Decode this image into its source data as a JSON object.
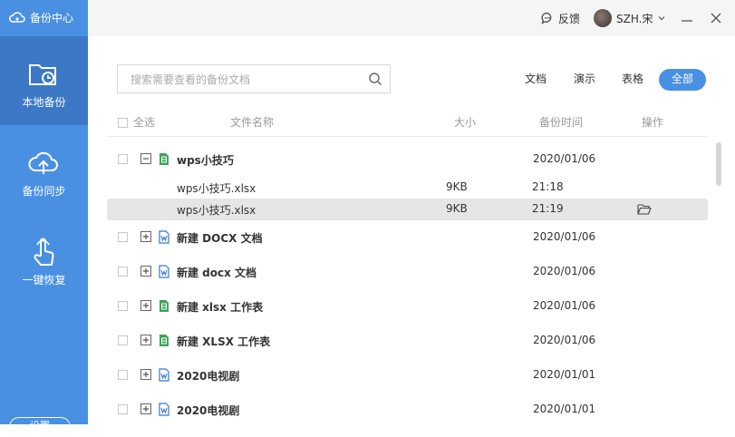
{
  "app": {
    "title": "备份中心"
  },
  "sidebar": {
    "items": [
      {
        "label": "本地备份",
        "icon": "folder-clock-icon",
        "active": true
      },
      {
        "label": "备份同步",
        "icon": "cloud-upload-icon",
        "active": false
      },
      {
        "label": "一键恢复",
        "icon": "hand-pointer-icon",
        "active": false
      }
    ],
    "bottom_button": "设置"
  },
  "topbar": {
    "feedback": "反馈",
    "user": "SZH.宋"
  },
  "search": {
    "placeholder": "搜索需要查看的备份文档"
  },
  "filters": [
    "文档",
    "演示",
    "表格",
    "全部"
  ],
  "table": {
    "headers": {
      "select_all": "全选",
      "name": "文件名称",
      "size": "大小",
      "time": "备份时间",
      "action": "操作"
    },
    "rows": [
      {
        "name": "wps小技巧",
        "size": "",
        "time": "2020/01/06",
        "type": "xlsx",
        "expanded": true
      },
      {
        "name": "wps小技巧.xlsx",
        "size": "9KB",
        "time": "21:18"
      },
      {
        "name": "wps小技巧.xlsx",
        "size": "9KB",
        "time": "21:19"
      },
      {
        "name": "新建 DOCX 文档",
        "size": "",
        "time": "2020/01/06",
        "type": "docx"
      },
      {
        "name": "新建 docx 文档",
        "size": "",
        "time": "2020/01/06",
        "type": "docx"
      },
      {
        "name": "新建 xlsx 工作表",
        "size": "",
        "time": "2020/01/06",
        "type": "xlsx"
      },
      {
        "name": "新建 XLSX 工作表",
        "size": "",
        "time": "2020/01/06",
        "type": "xlsx"
      },
      {
        "name": "2020电视剧",
        "size": "",
        "time": "2020/01/01",
        "type": "docx"
      },
      {
        "name": "2020电视剧",
        "size": "",
        "time": "2020/01/01",
        "type": "docx"
      }
    ]
  },
  "colors": {
    "accent": "#4a90e2",
    "sidebar_active": "#3c78c6",
    "excel_green": "#3fa35a",
    "word_blue": "#3a78c8"
  }
}
